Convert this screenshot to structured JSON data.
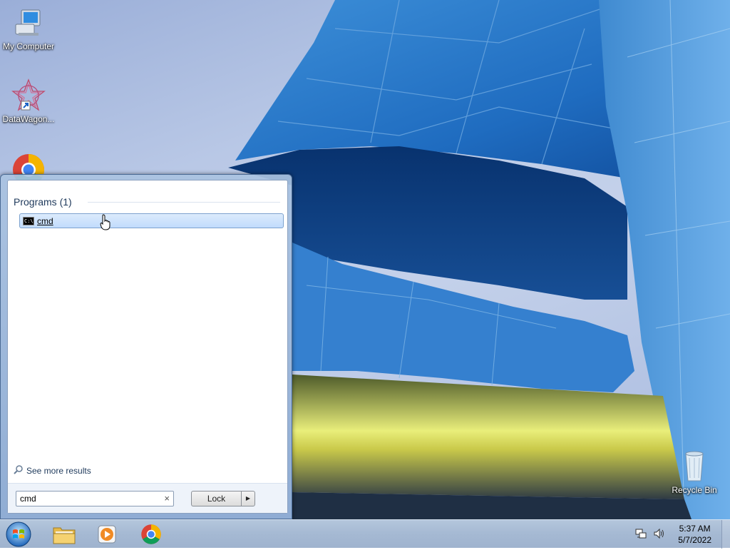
{
  "desktop": {
    "icons": [
      {
        "label": "My Computer"
      },
      {
        "label": "DataWagon..."
      },
      {
        "label": "Recycle Bin"
      }
    ]
  },
  "start_menu": {
    "programs_header": "Programs (1)",
    "results": [
      {
        "label": "cmd",
        "icon": "command-prompt-icon"
      }
    ],
    "see_more": "See more results",
    "search": {
      "value": "cmd",
      "clear": "×"
    },
    "power_button": {
      "label": "Lock",
      "arrow": "▶"
    }
  },
  "taskbar": {
    "pinned": [
      {
        "name": "file-explorer",
        "icon": "folder-icon"
      },
      {
        "name": "media-player",
        "icon": "media-player-icon"
      },
      {
        "name": "chrome",
        "icon": "chrome-icon"
      }
    ],
    "clock": {
      "time": "5:37 AM",
      "date": "5/7/2022"
    }
  }
}
